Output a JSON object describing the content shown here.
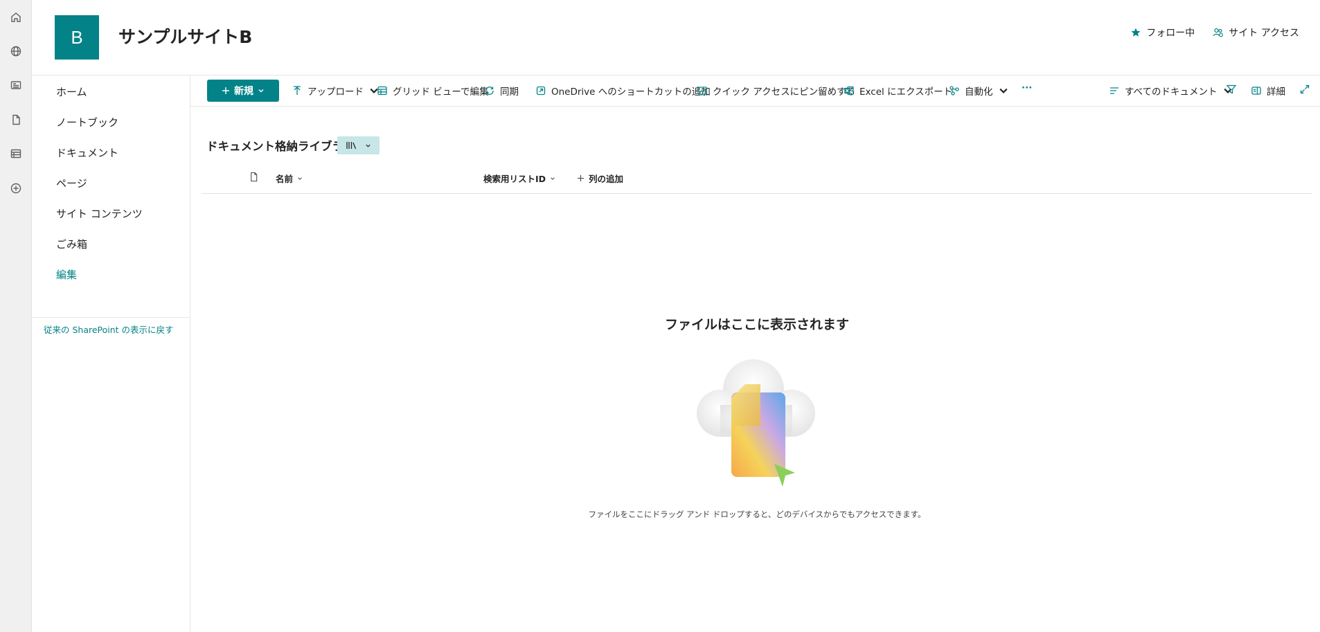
{
  "site": {
    "logo_letter": "B",
    "title": "サンプルサイトB",
    "follow_label": "フォロー中",
    "site_access_label": "サイト アクセス",
    "accent_color": "#038387"
  },
  "rail": {
    "icons": [
      "home-icon",
      "globe-icon",
      "news-icon",
      "file-icon",
      "list-icon",
      "add-circle-icon"
    ]
  },
  "leftnav": {
    "items": [
      {
        "label": "ホーム"
      },
      {
        "label": "ノートブック"
      },
      {
        "label": "ドキュメント"
      },
      {
        "label": "ページ"
      },
      {
        "label": "サイト コンテンツ"
      },
      {
        "label": "ごみ箱"
      }
    ],
    "edit_label": "編集",
    "classic_link": "従来の SharePoint の表示に戻す"
  },
  "cmdbar": {
    "new_label": "新規",
    "upload_label": "アップロード",
    "grid_edit_label": "グリッド ビューで編集",
    "sync_label": "同期",
    "onedrive_label": "OneDrive へのショートカットの追加",
    "pin_label": "クイック アクセスにピン留めする",
    "excel_label": "Excel にエクスポート",
    "automate_label": "自動化",
    "more_label": "···",
    "view_label": "すべてのドキュメント",
    "details_label": "詳細"
  },
  "library": {
    "title": "ドキュメント格納ライブラリ",
    "columns": {
      "name": "名前",
      "search_id": "検索用リストID",
      "add_column": "列の追加"
    },
    "empty_title": "ファイルはここに表示されます",
    "empty_subtitle": "ファイルをここにドラッグ アンド ドロップすると、どのデバイスからでもアクセスできます。"
  }
}
